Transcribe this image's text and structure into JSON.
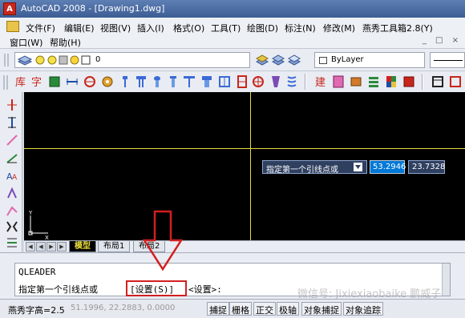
{
  "window": {
    "title": "AutoCAD 2008 - [Drawing1.dwg]",
    "logo_letter": "A",
    "controls": {
      "minimize": "_",
      "restore": "□",
      "close": "X"
    }
  },
  "menu": {
    "row1": [
      "文件(F)",
      "编辑(E)",
      "视图(V)",
      "插入(I)",
      "格式(O)",
      "工具(T)",
      "绘图(D)",
      "标注(N)",
      "修改(M)",
      "燕秀工具箱2.8(Y)"
    ],
    "row2": [
      "窗口(W)",
      "帮助(H)"
    ],
    "doc_controls": "_ □ ×"
  },
  "layer_toolbar": {
    "layer_name": "0",
    "color_value": "ByLayer"
  },
  "canvas": {
    "tooltip_prompt": "指定第一个引线点或",
    "coord_x": "53.2946",
    "coord_y": "23.7328",
    "ucs_y_label": "Y",
    "ucs_x_label": "X"
  },
  "layout_tabs": [
    "模型",
    "布局1",
    "布局2"
  ],
  "command": {
    "history_line": "QLEADER",
    "prompt": "指定第一个引线点或",
    "option": "[设置(S)]",
    "suffix": "<设置>:",
    "watermark": "微信号: Jixiexiaobaike 鹏威子"
  },
  "status": {
    "text_height": "燕秀字高=2.5",
    "coordinates": "51.1996, 22.2883, 0.0000",
    "toggles": [
      "捕捉",
      "栅格",
      "正交",
      "极轴",
      "对象捕捉",
      "对象追踪"
    ]
  },
  "colors": {
    "highlight_red": "#d21f1f",
    "crosshair": "#e6dc3c",
    "coord_active": "#0078d7"
  }
}
